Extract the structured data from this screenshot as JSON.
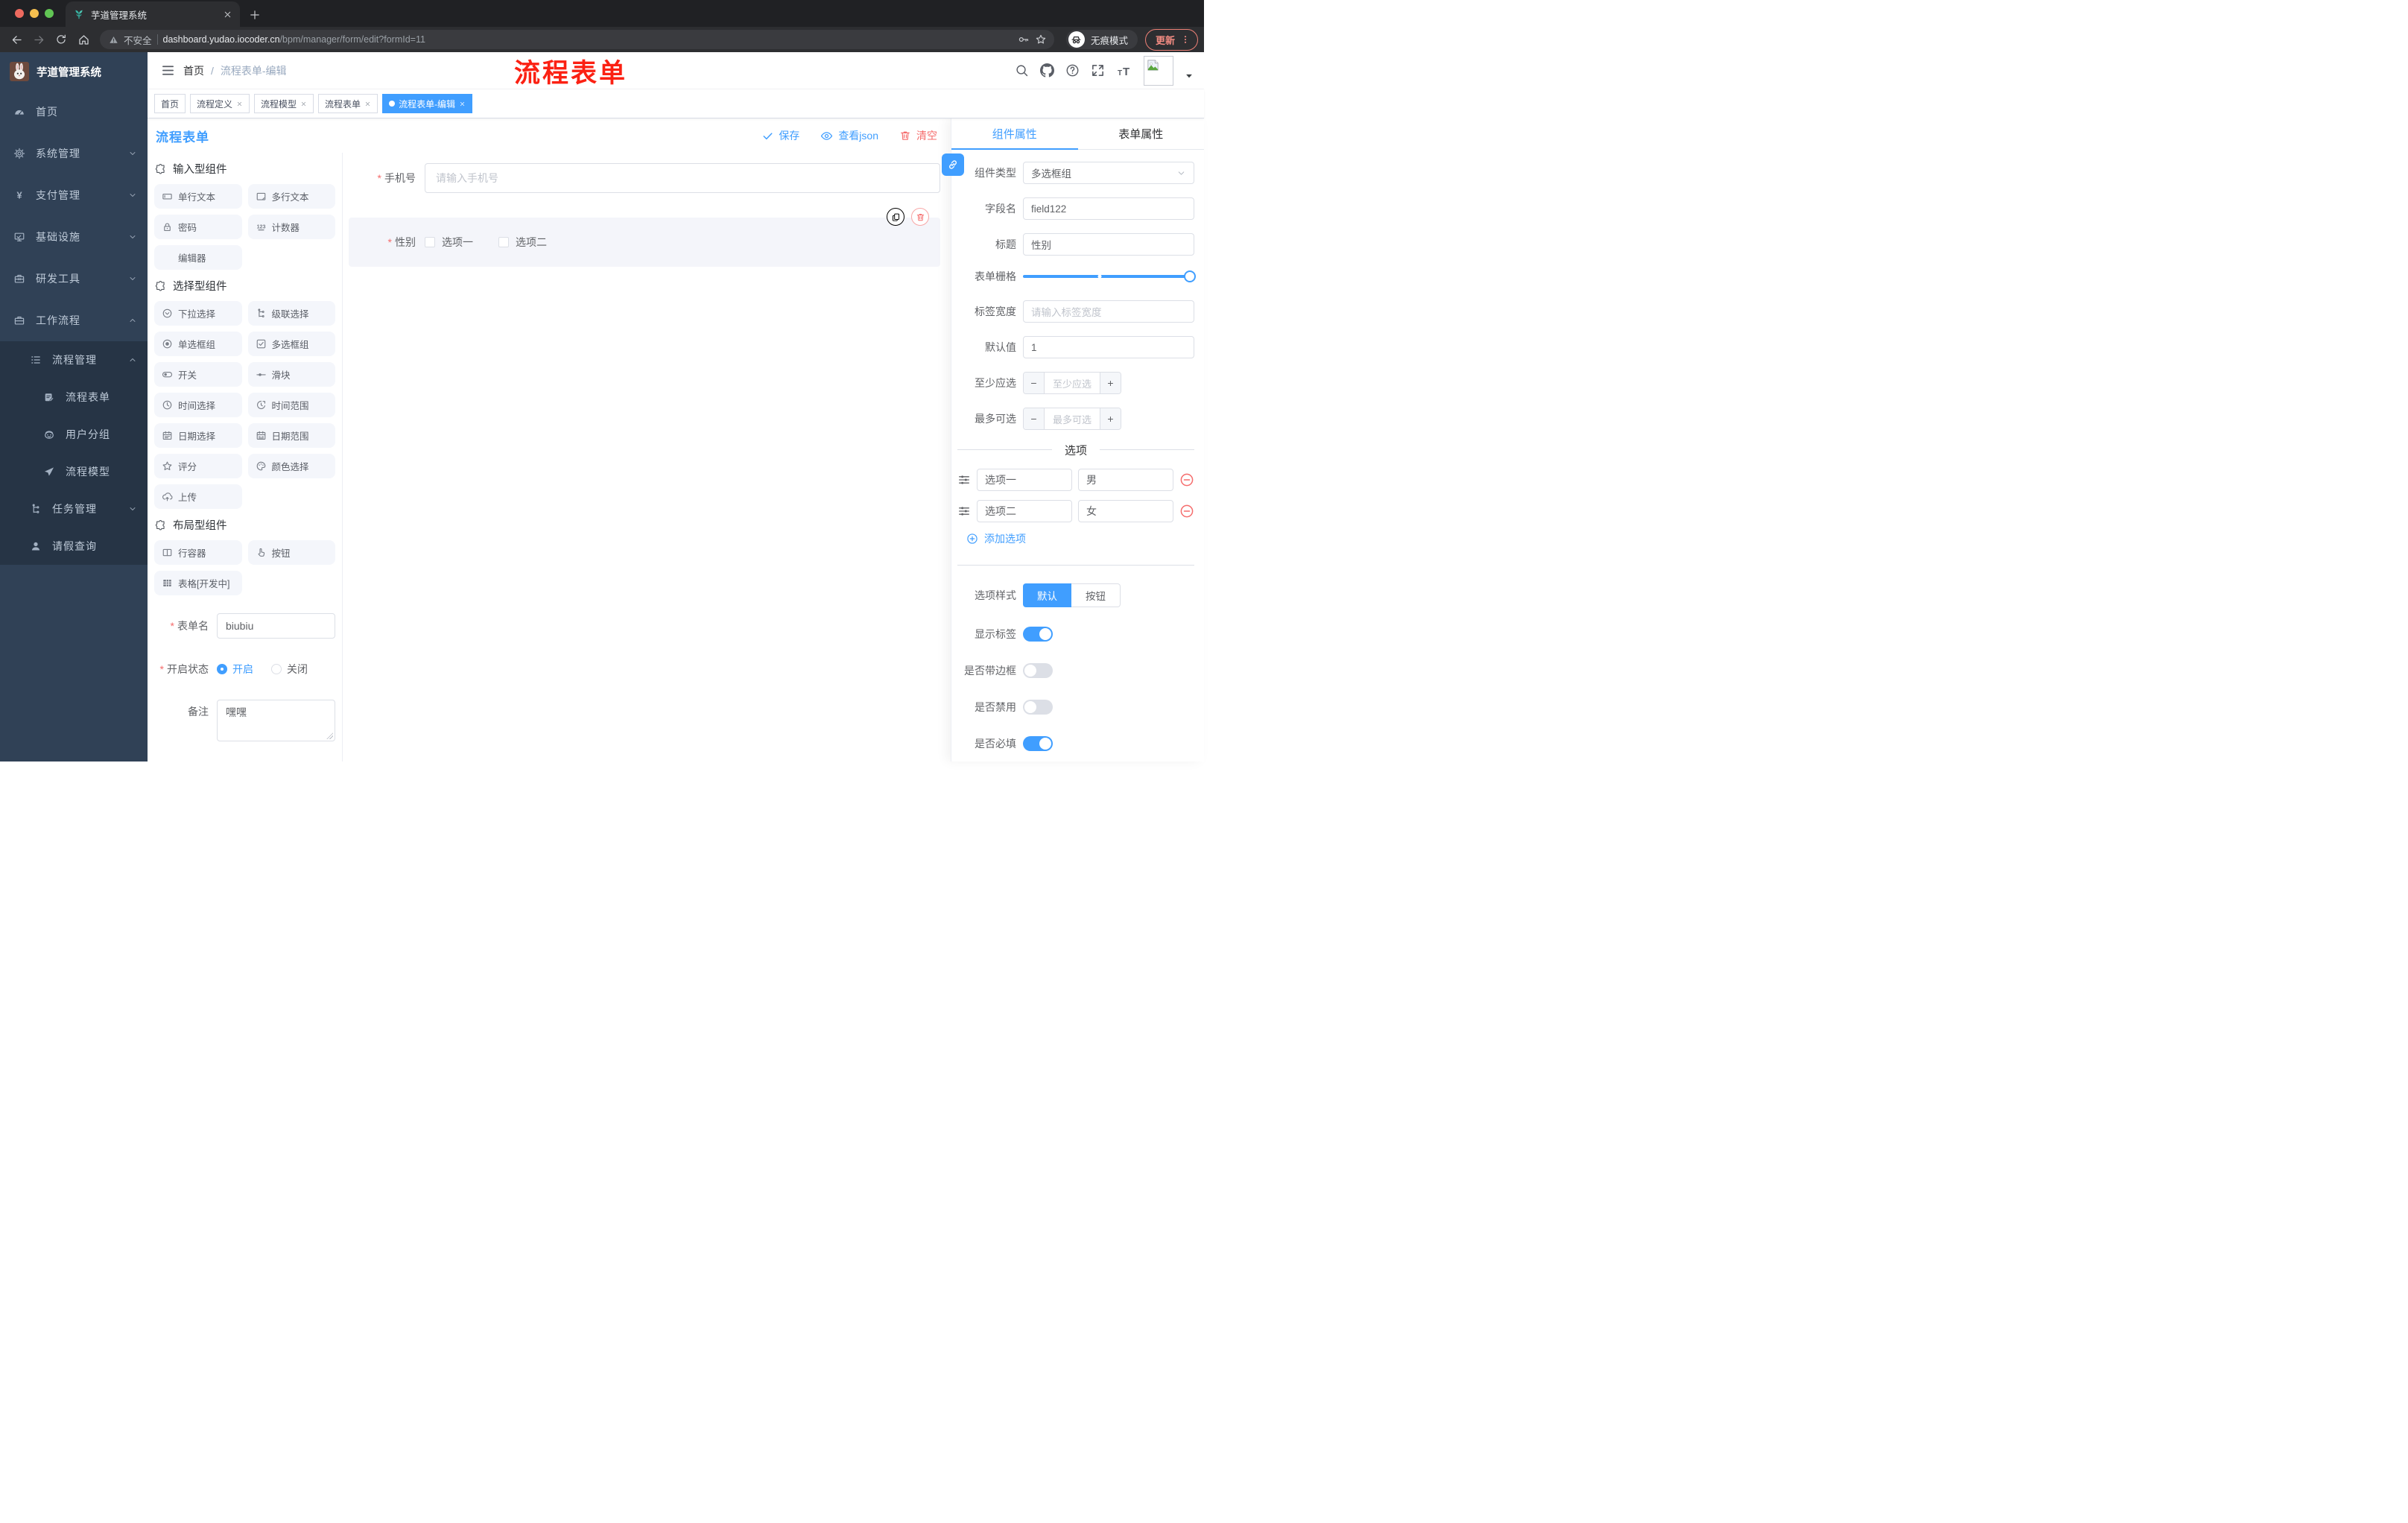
{
  "browser": {
    "tab_title": "芋道管理系统",
    "security_label": "不安全",
    "url_host": "dashboard.yudao.iocoder.cn",
    "url_path": "/bpm/manager/form/edit?formId=11",
    "incognito_label": "无痕模式",
    "update_label": "更新"
  },
  "sidebar": {
    "app_title": "芋道管理系统",
    "items": [
      {
        "id": "home",
        "label": "首页",
        "icon": "dashboard-icon",
        "chevron": null
      },
      {
        "id": "system",
        "label": "系统管理",
        "icon": "gear-icon",
        "chevron": "down"
      },
      {
        "id": "payment",
        "label": "支付管理",
        "icon": "yen-icon",
        "chevron": "down"
      },
      {
        "id": "infra",
        "label": "基础设施",
        "icon": "monitor-icon",
        "chevron": "down"
      },
      {
        "id": "devtools",
        "label": "研发工具",
        "icon": "toolbox-icon",
        "chevron": "down"
      },
      {
        "id": "workflow",
        "label": "工作流程",
        "icon": "briefcase-icon",
        "chevron": "up"
      }
    ],
    "submenu": [
      {
        "id": "process-mgmt",
        "label": "流程管理",
        "icon": "list-icon",
        "chevron": "up",
        "level": 2
      },
      {
        "id": "process-form",
        "label": "流程表单",
        "icon": "form-icon",
        "chevron": null,
        "level": 3
      },
      {
        "id": "user-group",
        "label": "用户分组",
        "icon": "face-icon",
        "chevron": null,
        "level": 3
      },
      {
        "id": "process-model",
        "label": "流程模型",
        "icon": "send-icon",
        "chevron": null,
        "level": 3
      },
      {
        "id": "task-mgmt",
        "label": "任务管理",
        "icon": "tree-icon",
        "chevron": "down",
        "level": 2
      },
      {
        "id": "leave-query",
        "label": "请假查询",
        "icon": "user-icon",
        "chevron": null,
        "level": 2
      }
    ]
  },
  "header": {
    "breadcrumb": {
      "home": "首页",
      "separator": "/",
      "current": "流程表单-编辑"
    },
    "annotation": "流程表单"
  },
  "tags": [
    {
      "id": "home",
      "label": "首页",
      "closable": false,
      "active": false
    },
    {
      "id": "process-definition",
      "label": "流程定义",
      "closable": true,
      "active": false
    },
    {
      "id": "process-model",
      "label": "流程模型",
      "closable": true,
      "active": false
    },
    {
      "id": "process-form",
      "label": "流程表单",
      "closable": true,
      "active": false
    },
    {
      "id": "process-form-edit",
      "label": "流程表单-编辑",
      "closable": true,
      "active": true
    }
  ],
  "toolbar": {
    "title": "流程表单",
    "save": "保存",
    "view_json": "查看json",
    "clear": "清空"
  },
  "palette": {
    "sections": [
      {
        "title": "输入型组件",
        "items": [
          {
            "id": "single-text",
            "label": "单行文本",
            "icon": "input"
          },
          {
            "id": "multi-text",
            "label": "多行文本",
            "icon": "textarea"
          },
          {
            "id": "password",
            "label": "密码",
            "icon": "lock"
          },
          {
            "id": "counter",
            "label": "计数器",
            "icon": "counter"
          },
          {
            "id": "editor",
            "label": "编辑器",
            "icon": null
          }
        ]
      },
      {
        "title": "选择型组件",
        "items": [
          {
            "id": "select",
            "label": "下拉选择",
            "icon": "select"
          },
          {
            "id": "cascade",
            "label": "级联选择",
            "icon": "cascade"
          },
          {
            "id": "radio-group",
            "label": "单选框组",
            "icon": "radio"
          },
          {
            "id": "checkbox-group",
            "label": "多选框组",
            "icon": "checkbox"
          },
          {
            "id": "switch",
            "label": "开关",
            "icon": "switch"
          },
          {
            "id": "slider",
            "label": "滑块",
            "icon": "slider"
          },
          {
            "id": "time",
            "label": "时间选择",
            "icon": "time"
          },
          {
            "id": "time-range",
            "label": "时间范围",
            "icon": "time-range"
          },
          {
            "id": "date",
            "label": "日期选择",
            "icon": "date"
          },
          {
            "id": "date-range",
            "label": "日期范围",
            "icon": "date-range"
          },
          {
            "id": "rate",
            "label": "评分",
            "icon": "star"
          },
          {
            "id": "color",
            "label": "颜色选择",
            "icon": "palette"
          },
          {
            "id": "upload",
            "label": "上传",
            "icon": "upload"
          }
        ]
      },
      {
        "title": "布局型组件",
        "items": [
          {
            "id": "row",
            "label": "行容器",
            "icon": "row"
          },
          {
            "id": "button",
            "label": "按钮",
            "icon": "hand"
          },
          {
            "id": "table",
            "label": "表格[开发中]",
            "icon": "table"
          }
        ]
      }
    ],
    "form": {
      "name_label": "表单名",
      "name_value": "biubiu",
      "status_label": "开启状态",
      "status_on": "开启",
      "status_off": "关闭",
      "remark_label": "备注",
      "remark_value": "嘿嘿"
    }
  },
  "canvas": {
    "phone": {
      "label": "手机号",
      "required": true,
      "placeholder": "请输入手机号"
    },
    "gender": {
      "label": "性别",
      "required": true,
      "options": [
        "选项一",
        "选项二"
      ]
    }
  },
  "panel": {
    "tabs": [
      "组件属性",
      "表单属性"
    ],
    "active_tab": "组件属性",
    "fields": {
      "type_label": "组件类型",
      "type_value": "多选框组",
      "name_label": "字段名",
      "name_value": "field122",
      "title_label": "标题",
      "title_value": "性别",
      "grid_label": "表单栅格",
      "label_width_label": "标签宽度",
      "label_width_placeholder": "请输入标签宽度",
      "default_label": "默认值",
      "default_value": "1",
      "min_label": "至少应选",
      "min_placeholder": "至少应选",
      "max_label": "最多可选",
      "max_placeholder": "最多可选"
    },
    "options_divider": "选项",
    "options": [
      {
        "label": "选项一",
        "value": "男"
      },
      {
        "label": "选项二",
        "value": "女"
      }
    ],
    "add_option": "添加选项",
    "style_label": "选项样式",
    "style_default": "默认",
    "style_button": "按钮",
    "toggles": [
      {
        "id": "show-label",
        "label": "显示标签",
        "on": true
      },
      {
        "id": "with-border",
        "label": "是否带边框",
        "on": false
      },
      {
        "id": "disabled",
        "label": "是否禁用",
        "on": false
      },
      {
        "id": "required",
        "label": "是否必填",
        "on": true
      }
    ]
  },
  "colors": {
    "accent": "#409eff",
    "danger": "#f56c6c",
    "annotation": "#fb2113",
    "sidebar_bg": "#304156",
    "submenu_bg": "#263445"
  },
  "icons": {
    "plant-favicon-icon": "teal sprout",
    "search-icon": "magnifier",
    "github-icon": "octocat",
    "help-icon": "question circle",
    "fullscreen-icon": "expand arrows",
    "font-size-icon": "tT",
    "avatar-icon": "broken image placeholder",
    "incognito-icon": "hat and glasses",
    "key-icon": "key",
    "bookmark-icon": "star outline",
    "more-icon": "vertical dots"
  }
}
